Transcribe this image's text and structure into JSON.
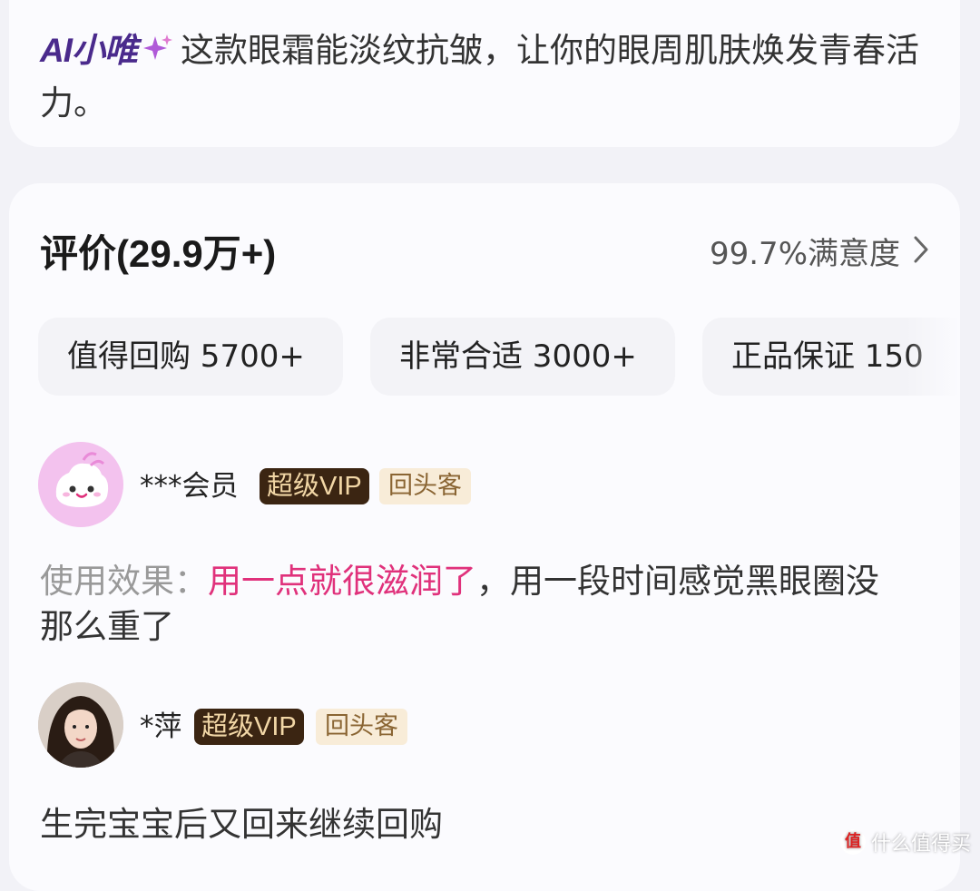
{
  "ai_summary": {
    "brand": "AI小唯",
    "text": "这款眼霜能淡纹抗皱，让你的眼周肌肤焕发青春活力。"
  },
  "reviews": {
    "title": "评价(29.9万+)",
    "satisfaction": "99.7%满意度",
    "tags": [
      {
        "label": "值得回购 5700+"
      },
      {
        "label": "非常合适 3000+"
      },
      {
        "label": "正品保证 150"
      }
    ],
    "items": [
      {
        "user": "***会员",
        "vip": "超级VIP",
        "badge": "回头客",
        "label": "使用效果：",
        "highlight": "用一点就很滋润了",
        "text": "，用一段时间感觉黑眼圈没那么重了"
      },
      {
        "user": "*萍",
        "vip": "超级VIP",
        "badge": "回头客",
        "text": "生完宝宝后又回来继续回购"
      }
    ]
  },
  "watermark": {
    "icon_text": "值",
    "text": "什么值得买"
  },
  "colors": {
    "accent_brand": "#4a2a8c",
    "highlight": "#e0317b",
    "vip_bg": "#3b2512",
    "vip_text": "#f2d7a6",
    "returner_bg": "#f8ecd8",
    "returner_text": "#8a6533"
  },
  "icons": [
    "sparkle-icon",
    "chevron-right-icon",
    "avatar-mascot-icon",
    "avatar-photo-icon"
  ]
}
